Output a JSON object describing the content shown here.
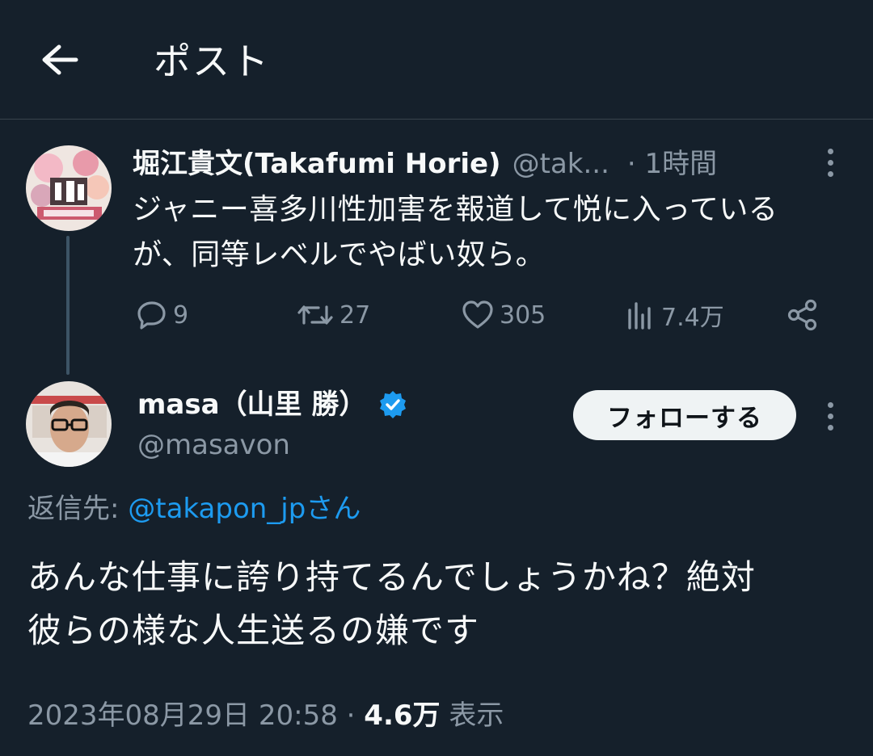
{
  "header": {
    "title": "ポスト"
  },
  "parent_post": {
    "author_name": "堀江貴文(Takafumi Horie)",
    "author_handle": "@tak...",
    "time": "· 1時間",
    "text_line1": "ジャニー喜多川性加害を報道して悦に入っている",
    "text_line2": "が、同等レベルでやばい奴ら。",
    "actions": {
      "replies": "9",
      "reposts": "27",
      "likes": "305",
      "views": "7.4万"
    }
  },
  "reply_post": {
    "author_name": "masa（山里 勝）",
    "author_handle": "@masavon",
    "follow_label": "フォローする",
    "replying_to_prefix": "返信先: ",
    "replying_to_mention": "@takapon_jp",
    "replying_to_suffix": "さん",
    "text_line1": "あんな仕事に誇り持てるんでしょうかね？絶対",
    "text_line2": "彼らの様な人生送るの嫌です",
    "timestamp": "2023年08月29日 20:58",
    "separator": " · ",
    "views_count": "4.6万",
    "views_label": " 表示"
  },
  "colors": {
    "background": "#15202b",
    "text_primary": "#f7f9f9",
    "text_secondary": "#8b98a5",
    "accent": "#1d9bf0",
    "divider": "#38444d"
  },
  "icons": {
    "back": "arrow-left-icon",
    "reply": "speech-bubble-icon",
    "repost": "repost-arrows-icon",
    "like": "heart-icon",
    "views": "bar-chart-icon",
    "share": "share-nodes-icon",
    "more": "vertical-dots-icon",
    "verified": "verified-badge-icon"
  }
}
